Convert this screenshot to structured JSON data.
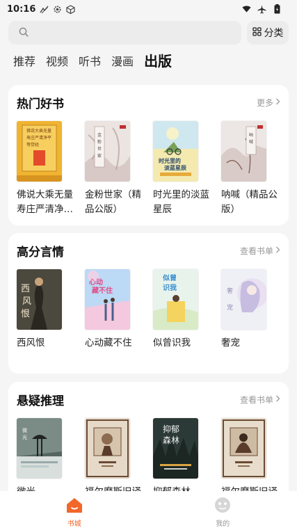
{
  "status_bar": {
    "time": "10:16"
  },
  "search": {
    "placeholder": ""
  },
  "category_button": {
    "label": "分类"
  },
  "tabs": [
    {
      "label": "推荐",
      "active": false
    },
    {
      "label": "视频",
      "active": false
    },
    {
      "label": "听书",
      "active": false
    },
    {
      "label": "漫画",
      "active": false
    },
    {
      "label": "出版",
      "active": true
    }
  ],
  "sections": [
    {
      "title": "热门好书",
      "more": "更多",
      "books": [
        {
          "title": "佛说大乘无量寿庄严清净…"
        },
        {
          "title": "金粉世家（精品公版）"
        },
        {
          "title": "时光里的淡蓝星辰"
        },
        {
          "title": "呐喊（精品公版）"
        }
      ]
    },
    {
      "title": "高分言情",
      "more": "查看书单",
      "books": [
        {
          "title": "西风恨"
        },
        {
          "title": "心动藏不住"
        },
        {
          "title": "似曾识我"
        },
        {
          "title": "奢宠"
        }
      ]
    },
    {
      "title": "悬疑推理",
      "more": "查看书单",
      "books": [
        {
          "title": "微光"
        },
        {
          "title": "福尔摩斯旧译"
        },
        {
          "title": "抑郁森林"
        },
        {
          "title": "福尔摩斯旧译"
        }
      ]
    }
  ],
  "bottom_nav": [
    {
      "label": "书城",
      "active": true
    },
    {
      "label": "我的",
      "active": false
    }
  ],
  "colors": {
    "accent": "#f2672a",
    "muted": "#999999"
  }
}
